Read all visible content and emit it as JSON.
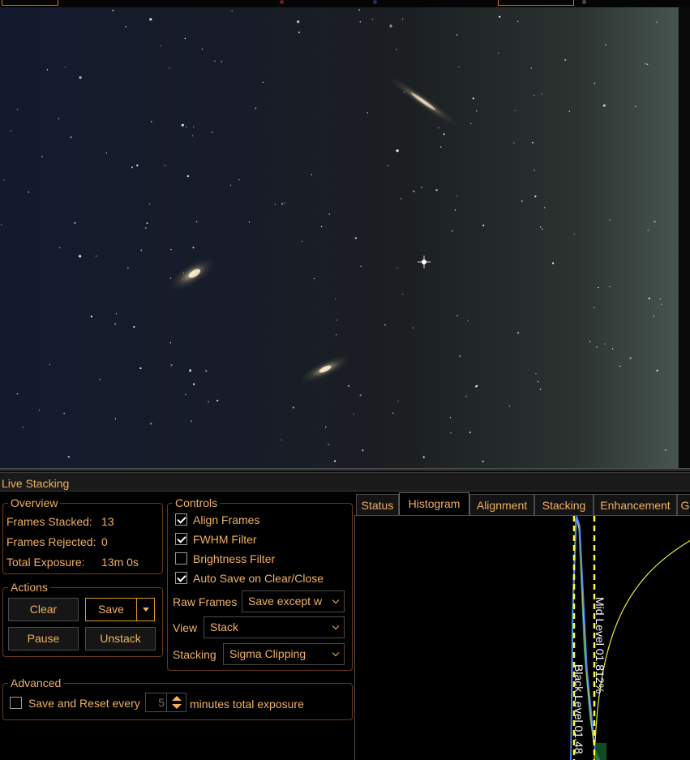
{
  "window": {
    "panel_title": "Live Stacking"
  },
  "overview": {
    "title": "Overview",
    "frames_stacked_label": "Frames Stacked:",
    "frames_stacked_value": "13",
    "frames_rejected_label": "Frames Rejected:",
    "frames_rejected_value": "0",
    "total_exposure_label": "Total Exposure:",
    "total_exposure_value": "13m 0s"
  },
  "actions": {
    "title": "Actions",
    "clear_label": "Clear",
    "save_label": "Save",
    "pause_label": "Pause",
    "unstack_label": "Unstack"
  },
  "controls": {
    "title": "Controls",
    "align_frames": {
      "label": "Align Frames",
      "checked": true
    },
    "fwhm_filter": {
      "label": "FWHM Filter",
      "checked": true
    },
    "brightness_filter": {
      "label": "Brightness Filter",
      "checked": false
    },
    "auto_save": {
      "label": "Auto Save on Clear/Close",
      "checked": true
    },
    "raw_frames_label": "Raw Frames",
    "raw_frames_value": "Save except w",
    "view_label": "View",
    "view_value": "Stack",
    "stacking_label": "Stacking",
    "stacking_value": "Sigma Clipping"
  },
  "advanced": {
    "title": "Advanced",
    "save_reset": {
      "label": "Save and Reset every",
      "checked": false
    },
    "minutes_value": "5",
    "minutes_suffix": "minutes total exposure"
  },
  "tabs": [
    {
      "label": "Status",
      "active": false
    },
    {
      "label": "Histogram",
      "active": true
    },
    {
      "label": "Alignment",
      "active": false
    },
    {
      "label": "Stacking",
      "active": false
    },
    {
      "label": "Enhancement",
      "active": false
    },
    {
      "label": "G",
      "active": false
    }
  ],
  "histogram": {
    "mid_level_label": "Mid Level  01.812%",
    "black_level_label": "Black Level  01.48"
  },
  "colors": {
    "accent": "#f0b060",
    "border": "#6b3a10",
    "focus": "#e0962a",
    "level_line": "#ffff3a"
  }
}
